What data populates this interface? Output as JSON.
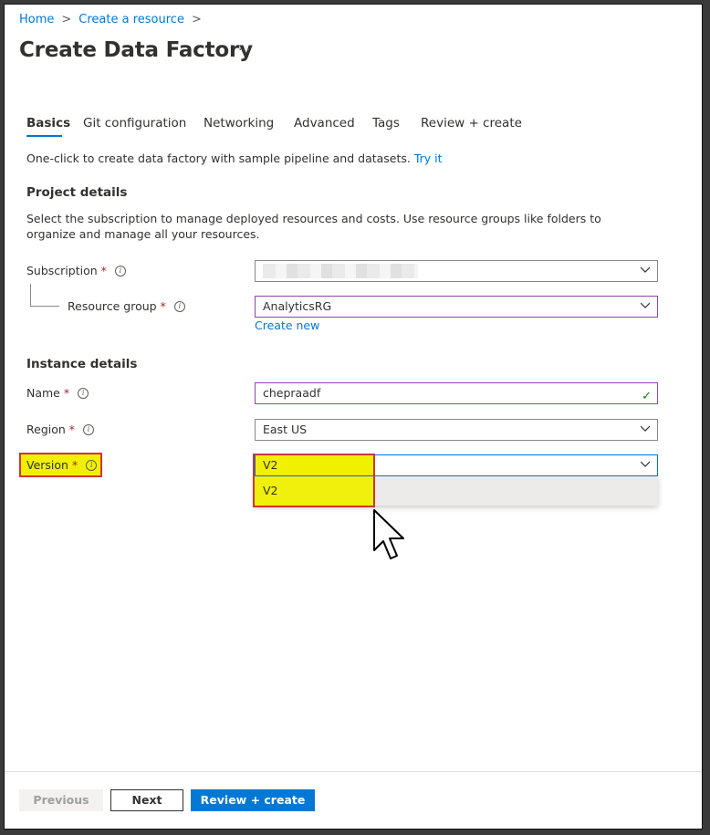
{
  "breadcrumb": {
    "items": [
      "Home",
      "Create a resource"
    ],
    "separator": ">"
  },
  "page": {
    "title": "Create Data Factory",
    "more_label": "···"
  },
  "tabs": [
    {
      "label": "Basics",
      "active": true
    },
    {
      "label": "Git configuration",
      "active": false
    },
    {
      "label": "Networking",
      "active": false
    },
    {
      "label": "Advanced",
      "active": false
    },
    {
      "label": "Tags",
      "active": false
    },
    {
      "label": "Review + create",
      "active": false
    }
  ],
  "intro": {
    "text": "One-click to create data factory with sample pipeline and datasets.",
    "link": "Try it"
  },
  "project_details": {
    "heading": "Project details",
    "description": "Select the subscription to manage deployed resources and costs. Use resource groups like folders to organize and manage all your resources.",
    "subscription": {
      "label": "Subscription",
      "value": ""
    },
    "resource_group": {
      "label": "Resource group",
      "value": "AnalyticsRG",
      "create_new": "Create new"
    }
  },
  "instance_details": {
    "heading": "Instance details",
    "name": {
      "label": "Name",
      "value": "chepraadf"
    },
    "region": {
      "label": "Region",
      "value": "East US"
    },
    "version": {
      "label": "Version",
      "value": "V2",
      "options": [
        "V2"
      ]
    }
  },
  "required_marker": "*",
  "info_glyph": "i",
  "footer": {
    "previous": "Previous",
    "next": "Next",
    "review_create": "Review + create"
  },
  "colors": {
    "accent": "#0078d4",
    "highlight": "#f1f000",
    "annotation_red": "#d13438",
    "valid_border": "#8b4a9e"
  }
}
